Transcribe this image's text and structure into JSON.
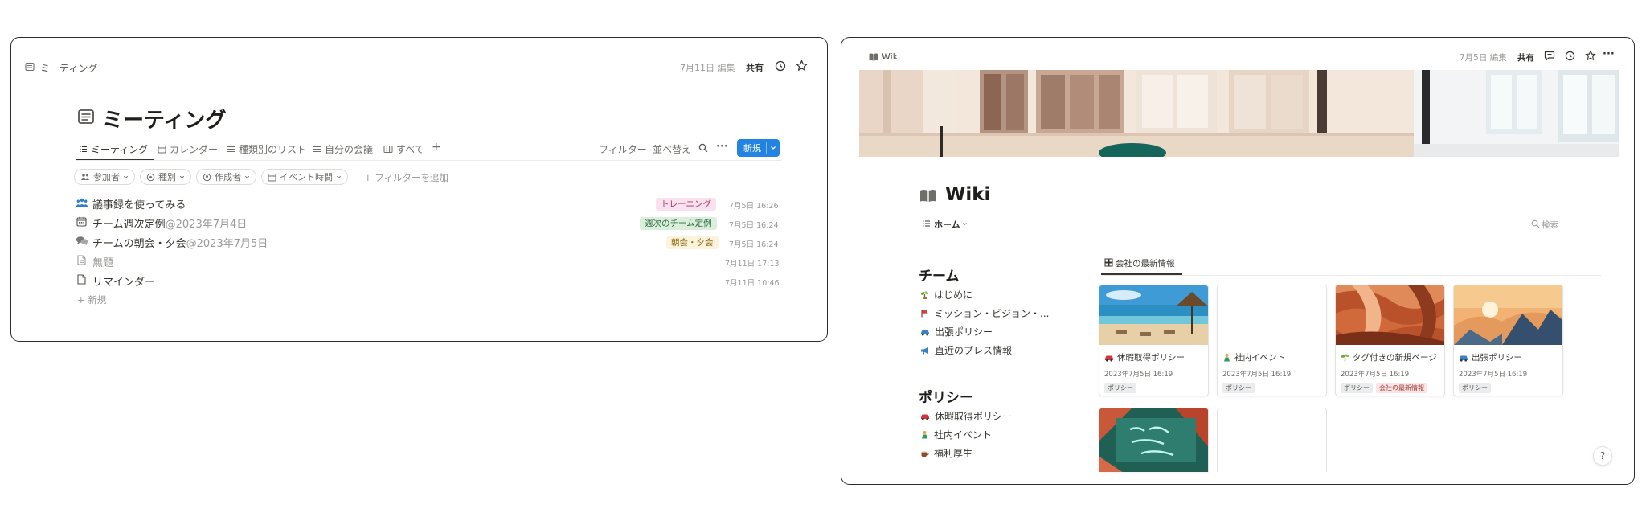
{
  "meeting": {
    "breadcrumb": "ミーティング",
    "edited": "7月11日 編集",
    "share": "共有",
    "title": "ミーティング",
    "tabs": [
      "ミーティング",
      "カレンダー",
      "種類別のリスト",
      "自分の会議",
      "すべて"
    ],
    "tab_add": "+",
    "filter": "フィルター",
    "sort": "並べ替え",
    "more": "···",
    "new_button": "新規",
    "filters": [
      "参加者",
      "種別",
      "作成者",
      "イベント時間"
    ],
    "add_filter": "+ フィルターを追加",
    "rows": [
      {
        "title": "議事録を使ってみる",
        "date": "",
        "tag": "トレーニング",
        "time": "7月5日 16:26"
      },
      {
        "title": "チーム週次定例",
        "date": "@2023年7月4日",
        "tag": "週次のチーム定例",
        "time": "7月5日 16:24"
      },
      {
        "title": "チームの朝会・夕会",
        "date": "@2023年7月5日",
        "tag": "朝会・夕会",
        "time": "7月5日 16:24"
      },
      {
        "title": "無題",
        "date": "",
        "tag": "",
        "time": "7月11日 17:13"
      },
      {
        "title": "リマインダー",
        "date": "",
        "tag": "",
        "time": "7月11日 10:46"
      }
    ],
    "new_row": "+ 新規",
    "tag_colors": {
      "training_bg": "#f9e1ee",
      "training_fg": "#a3336f",
      "weekly_bg": "#dbeddb",
      "weekly_fg": "#2b6e45",
      "morning_bg": "#fbf3db",
      "morning_fg": "#8a6a14"
    },
    "accent": "#2383e2"
  },
  "wiki": {
    "breadcrumb": "Wiki",
    "edited": "7月5日 編集",
    "share": "共有",
    "more": "···",
    "title": "Wiki",
    "view": "ホーム",
    "search": "検索",
    "team_heading": "チーム",
    "team_items": [
      {
        "label": "はじめに",
        "icon": "seedling-icon"
      },
      {
        "label": "ミッション・ビジョン・...",
        "icon": "flag-icon"
      },
      {
        "label": "出張ポリシー",
        "icon": "car-icon"
      },
      {
        "label": "直近のプレス情報",
        "icon": "megaphone-icon"
      }
    ],
    "policy_heading": "ポリシー",
    "policy_items": [
      {
        "label": "休暇取得ポリシー",
        "icon": "car-icon"
      },
      {
        "label": "社内イベント",
        "icon": "person-icon"
      },
      {
        "label": "福利厚生",
        "icon": "coffee-icon"
      }
    ],
    "gallery_tab": "会社の最新情報",
    "cards": [
      {
        "title": "休暇取得ポリシー",
        "date": "2023年7月5日 16:19",
        "tags": [
          "ポリシー"
        ],
        "icon": "car-icon"
      },
      {
        "title": "社内イベント",
        "date": "2023年7月5日 16:19",
        "tags": [
          "ポリシー"
        ],
        "icon": "person-icon"
      },
      {
        "title": "タグ付きの新規ページ",
        "date": "2023年7月5日 16:19",
        "tags": [
          "ポリシー",
          "会社の最新情報"
        ],
        "icon": "seedling-icon"
      },
      {
        "title": "出張ポリシー",
        "date": "2023年7月5日 16:19",
        "tags": [
          "ポリシー"
        ],
        "icon": "car-icon"
      }
    ],
    "help": "?"
  }
}
